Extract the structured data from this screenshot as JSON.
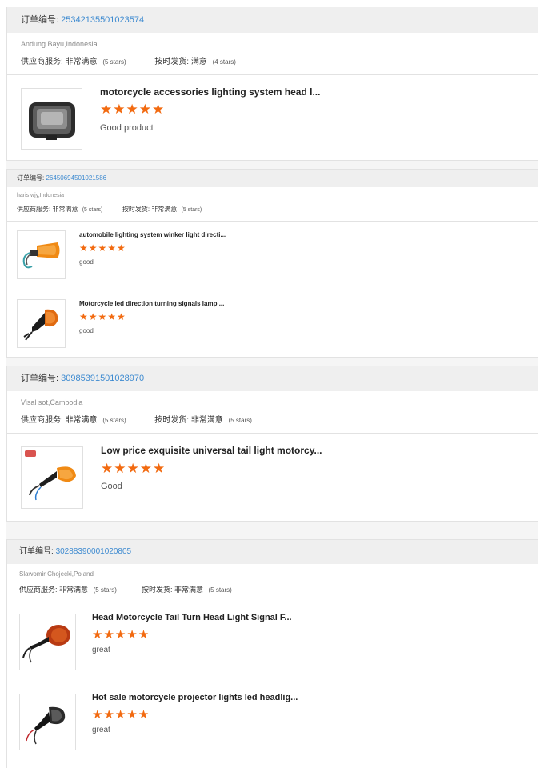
{
  "order_label": "订单编号:",
  "supplier_service_label": "供应商服务:",
  "ontime_label": "按时发货:",
  "star_glyphs": "★★★★★",
  "colors": {
    "accent_link": "#3d8ad0",
    "star": "#f26a10",
    "header_bg": "#efefef"
  },
  "orders": [
    {
      "order_number": "25342135501023574",
      "buyer": "Andung Bayu,Indonesia",
      "supplier_service_value": "非常满意",
      "supplier_service_stars": "(5 stars)",
      "ontime_value": "满意",
      "ontime_stars": "(4 stars)",
      "items": [
        {
          "title": "motorcycle accessories lighting system head l...",
          "rating": 5,
          "comment": "Good product",
          "image_icon": "headlight-image"
        }
      ]
    },
    {
      "order_number": "26450694501021586",
      "buyer": "haris wjy,Indonesia",
      "supplier_service_value": "非常满意",
      "supplier_service_stars": "(5 stars)",
      "ontime_value": "非常满意",
      "ontime_stars": "(5 stars)",
      "items": [
        {
          "title": "automobile lighting system winker light directi...",
          "rating": 5,
          "comment": "good",
          "image_icon": "orange-winker-image"
        },
        {
          "title": "Motorcycle led direction turning signals lamp ...",
          "rating": 5,
          "comment": "good",
          "image_icon": "black-turn-signal-image"
        }
      ]
    },
    {
      "order_number": "30985391501028970",
      "buyer": "Visal sot,Cambodia",
      "supplier_service_value": "非常满意",
      "supplier_service_stars": "(5 stars)",
      "ontime_value": "非常满意",
      "ontime_stars": "(5 stars)",
      "items": [
        {
          "title": "Low price exquisite universal tail light motorcy...",
          "rating": 5,
          "comment": "Good",
          "image_icon": "amber-indicator-image"
        }
      ]
    },
    {
      "order_number": "30288390001020805",
      "buyer": "Slawomir Chojecki,Poland",
      "supplier_service_value": "非常满意",
      "supplier_service_stars": "(5 stars)",
      "ontime_value": "非常满意",
      "ontime_stars": "(5 stars)",
      "items": [
        {
          "title": "Head Motorcycle Tail Turn Head Light Signal F...",
          "rating": 5,
          "comment": "great",
          "image_icon": "red-round-signal-image"
        },
        {
          "title": "Hot sale motorcycle projector lights led headlig...",
          "rating": 5,
          "comment": "great",
          "image_icon": "smoked-signal-image"
        }
      ]
    }
  ]
}
